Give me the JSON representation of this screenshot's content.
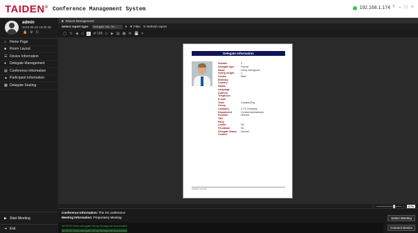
{
  "app": {
    "logo": "TAIDEN",
    "logo_mark": "®",
    "title": "Conference Management System",
    "ip": "192.168.1.174",
    "window_controls": [
      "?",
      "–",
      "□",
      "×"
    ]
  },
  "user": {
    "name": "admin",
    "datetime": "2019-06-26 16:05:38",
    "icons": [
      "lock-icon",
      "gear-icon",
      "power-icon"
    ]
  },
  "sidebar": {
    "items": [
      {
        "label": "Home Page",
        "icon": "home-icon"
      },
      {
        "label": "Room Layout",
        "icon": "room-icon"
      },
      {
        "label": "Device Information",
        "icon": "device-icon"
      },
      {
        "label": "Delegate Management",
        "icon": "person-icon"
      },
      {
        "label": "Conference Information",
        "icon": "list-icon"
      },
      {
        "label": "Participant Information",
        "icon": "people-icon"
      },
      {
        "label": "Delegate Seating",
        "icon": "seat-icon"
      }
    ],
    "start_meeting": "Start Meeting",
    "exit": "Exit"
  },
  "tab": {
    "label": "Report Management"
  },
  "filter": {
    "type_label": "Select report type:",
    "type_value": "Delegate Info. Re...",
    "filter_label": "Filter",
    "refresh_label": "Refresh report"
  },
  "toolbar": {
    "page_current": "1",
    "page_total": "of 186"
  },
  "report": {
    "header": "Delegate Information",
    "fields": [
      {
        "label": "Number",
        "value": "3"
      },
      {
        "label": "Delegate type",
        "value": "Formal"
      },
      {
        "label": "Name",
        "value": "Henry Montgome"
      },
      {
        "label": "Voting weight",
        "value": "1"
      },
      {
        "label": "Gender",
        "value": "Male"
      },
      {
        "label": "Birthday",
        "value": ""
      },
      {
        "label": "Country",
        "value": ""
      },
      {
        "label": "Nation",
        "value": ""
      },
      {
        "label": "Language",
        "value": ""
      },
      {
        "label": "Address",
        "value": ""
      },
      {
        "label": "Telephone",
        "value": ""
      },
      {
        "label": "E-mail",
        "value": ""
      },
      {
        "label": "Team",
        "value": "Canada-Eng"
      },
      {
        "label": "Group",
        "value": ""
      },
      {
        "label": "Company",
        "value": "X-Tk Company"
      },
      {
        "label": "Department",
        "value": "Central Administrator"
      },
      {
        "label": "Position",
        "value": "Director"
      },
      {
        "label": "Title",
        "value": ""
      },
      {
        "label": "Party",
        "value": ""
      },
      {
        "label": "Leader",
        "value": "No"
      },
      {
        "label": "Presidium",
        "value": "No"
      },
      {
        "label": "Delegate Status",
        "value": "Normal"
      },
      {
        "label": "Content",
        "value": ""
      }
    ],
    "footer": "2019/6/26 16:05:38"
  },
  "zoom": {
    "value": "67%"
  },
  "info": {
    "conference_label": "Conference Information:",
    "conference_value": "The XX conference",
    "meeting_label": "Meeting Information:",
    "meeting_value": "Preparatory Meeting",
    "logs": [
      "16:05:29  Save delegate Henry Montgome succeeded",
      "16:05:30  Save delegate Henry Montgome succeeded"
    ],
    "select_meeting": "Select Meeting",
    "connect_device": "Connect Device"
  },
  "colors": {
    "brand": "#c8102e",
    "sidebar_bg": "#1c1c1c",
    "header_blue": "#101060",
    "label_red": "#8b1a1a",
    "log_green": "#3bb34a"
  }
}
